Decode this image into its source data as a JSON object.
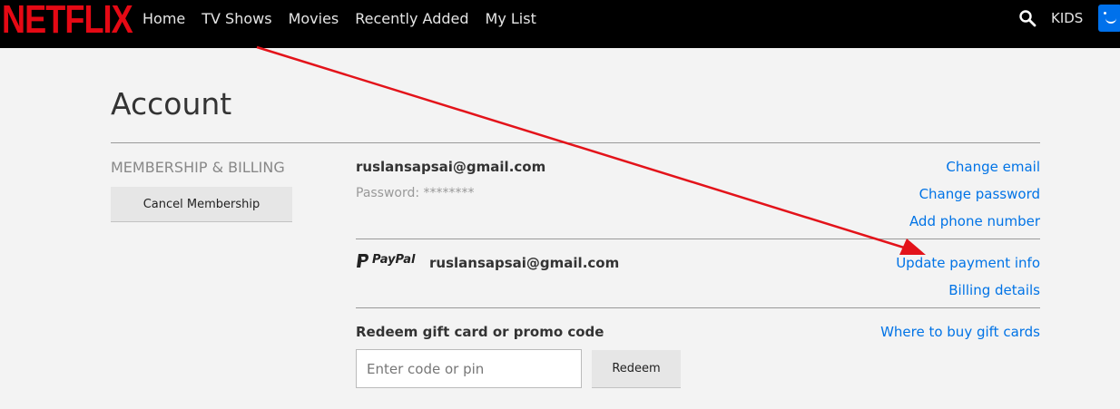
{
  "header": {
    "logo": "NETFLIX",
    "nav": [
      {
        "label": "Home"
      },
      {
        "label": "TV Shows"
      },
      {
        "label": "Movies"
      },
      {
        "label": "Recently Added"
      },
      {
        "label": "My List"
      }
    ],
    "kids_label": "KIDS",
    "icons": {
      "search": "search-icon",
      "avatar": "profile-avatar"
    }
  },
  "page": {
    "title": "Account"
  },
  "membership": {
    "section_label": "MEMBERSHIP & BILLING",
    "cancel_button": "Cancel Membership",
    "email": "ruslansapsai@gmail.com",
    "password_line": "Password: ********",
    "links": {
      "change_email": "Change email",
      "change_password": "Change password",
      "add_phone": "Add phone number"
    }
  },
  "payment": {
    "provider_label": "PayPal",
    "email": "ruslansapsai@gmail.com",
    "links": {
      "update_payment": "Update payment info",
      "billing_details": "Billing details"
    }
  },
  "redeem": {
    "title": "Redeem gift card or promo code",
    "where_to_buy": "Where to buy gift cards",
    "input_placeholder": "Enter code or pin",
    "button": "Redeem"
  },
  "colors": {
    "brand_red": "#e50914",
    "link_blue": "#0073e6",
    "header_bg": "#000000",
    "page_bg": "#f3f3f3",
    "annotation_arrow": "#e3131a"
  }
}
